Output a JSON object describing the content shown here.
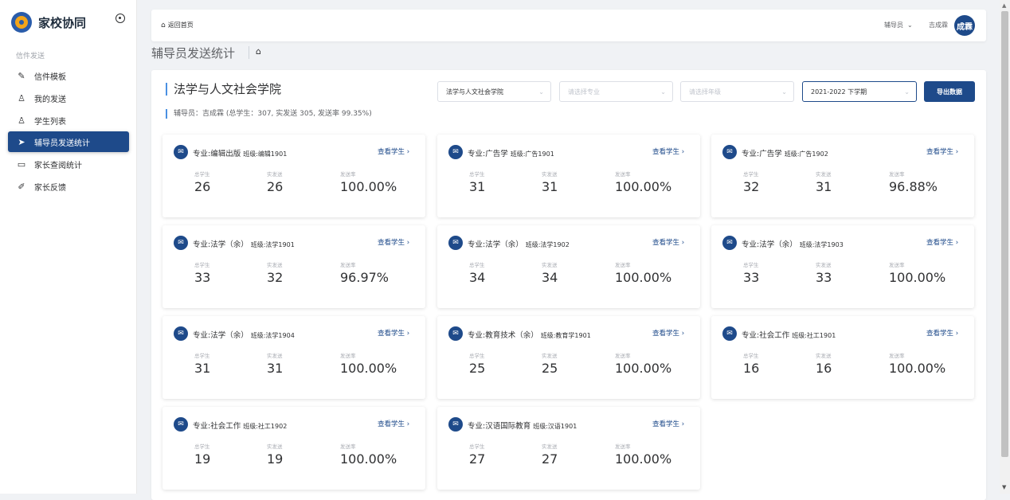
{
  "brand": {
    "name": "家校协同"
  },
  "sidebar": {
    "group_label": "信件发送",
    "items": [
      {
        "label": "信件模板",
        "icon": "edit-icon"
      },
      {
        "label": "我的发送",
        "icon": "user-icon"
      },
      {
        "label": "学生列表",
        "icon": "user-icon"
      },
      {
        "label": "辅导员发送统计",
        "icon": "send-icon",
        "active": true
      },
      {
        "label": "家长查阅统计",
        "icon": "tablet-icon"
      },
      {
        "label": "家长反馈",
        "icon": "pencil-icon"
      }
    ]
  },
  "header": {
    "back_home": "返回首页",
    "role": "辅导员",
    "user_name": "吉成霖",
    "avatar_text": "成霖"
  },
  "page": {
    "title": "辅导员发送统计"
  },
  "filters": {
    "college": "法学与人文社会学院",
    "major_placeholder": "请选择专业",
    "grade_placeholder": "请选择年级",
    "term": "2021-2022 下学期",
    "export_label": "导出数据"
  },
  "summary": {
    "college_title": "法学与人文社会学院",
    "text": "辅导员：吉成霖 (总学生：307, 实发送 305, 发送率 99.35%)"
  },
  "stat_labels": {
    "total": "总学生",
    "sent": "实发送",
    "rate": "发送率"
  },
  "view_link": "查看学生",
  "cards": [
    {
      "major": "专业:编辑出版",
      "class": "班级:编辑1901",
      "total": "26",
      "sent": "26",
      "rate": "100.00%"
    },
    {
      "major": "专业:广告学",
      "class": "班级:广告1901",
      "total": "31",
      "sent": "31",
      "rate": "100.00%"
    },
    {
      "major": "专业:广告学",
      "class": "班级:广告1902",
      "total": "32",
      "sent": "31",
      "rate": "96.88%"
    },
    {
      "major": "专业:法学（余）",
      "class": "班级:法学1901",
      "total": "33",
      "sent": "32",
      "rate": "96.97%"
    },
    {
      "major": "专业:法学（余）",
      "class": "班级:法学1902",
      "total": "34",
      "sent": "34",
      "rate": "100.00%"
    },
    {
      "major": "专业:法学（余）",
      "class": "班级:法学1903",
      "total": "33",
      "sent": "33",
      "rate": "100.00%"
    },
    {
      "major": "专业:法学（余）",
      "class": "班级:法学1904",
      "total": "31",
      "sent": "31",
      "rate": "100.00%"
    },
    {
      "major": "专业:教育技术（余）",
      "class": "班级:教育学1901",
      "total": "25",
      "sent": "25",
      "rate": "100.00%"
    },
    {
      "major": "专业:社会工作",
      "class": "班级:社工1901",
      "total": "16",
      "sent": "16",
      "rate": "100.00%"
    },
    {
      "major": "专业:社会工作",
      "class": "班级:社工1902",
      "total": "19",
      "sent": "19",
      "rate": "100.00%"
    },
    {
      "major": "专业:汉语国际教育",
      "class": "班级:汉语1901",
      "total": "27",
      "sent": "27",
      "rate": "100.00%"
    }
  ]
}
